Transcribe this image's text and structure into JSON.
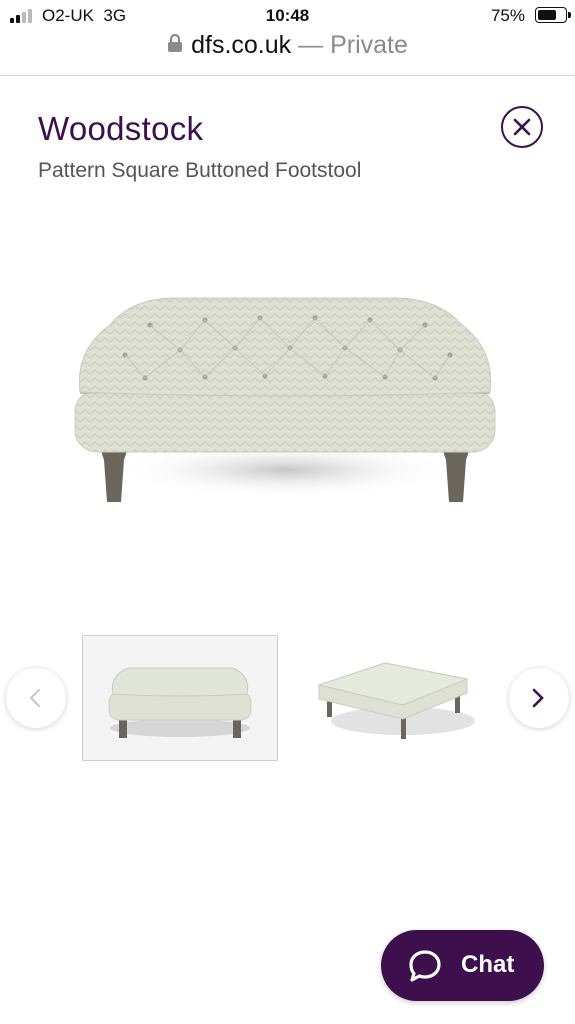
{
  "status_bar": {
    "carrier": "O2-UK",
    "network": "3G",
    "time": "10:48",
    "battery_percent": "75%",
    "battery_level": 0.75
  },
  "browser": {
    "host": "dfs.co.uk",
    "mode": "— Private",
    "icon": "lock-icon"
  },
  "product": {
    "title": "Woodstock",
    "subtitle": "Pattern Square Buttoned Footstool"
  },
  "gallery": {
    "thumbnails": [
      "front view",
      "angled view"
    ],
    "active_index": 0
  },
  "chat": {
    "label": "Chat",
    "icon": "chat-bubble-icon"
  },
  "colors": {
    "brand": "#3d0f4d",
    "fabric": "#dcdfd2",
    "legs": "#6b665c"
  }
}
